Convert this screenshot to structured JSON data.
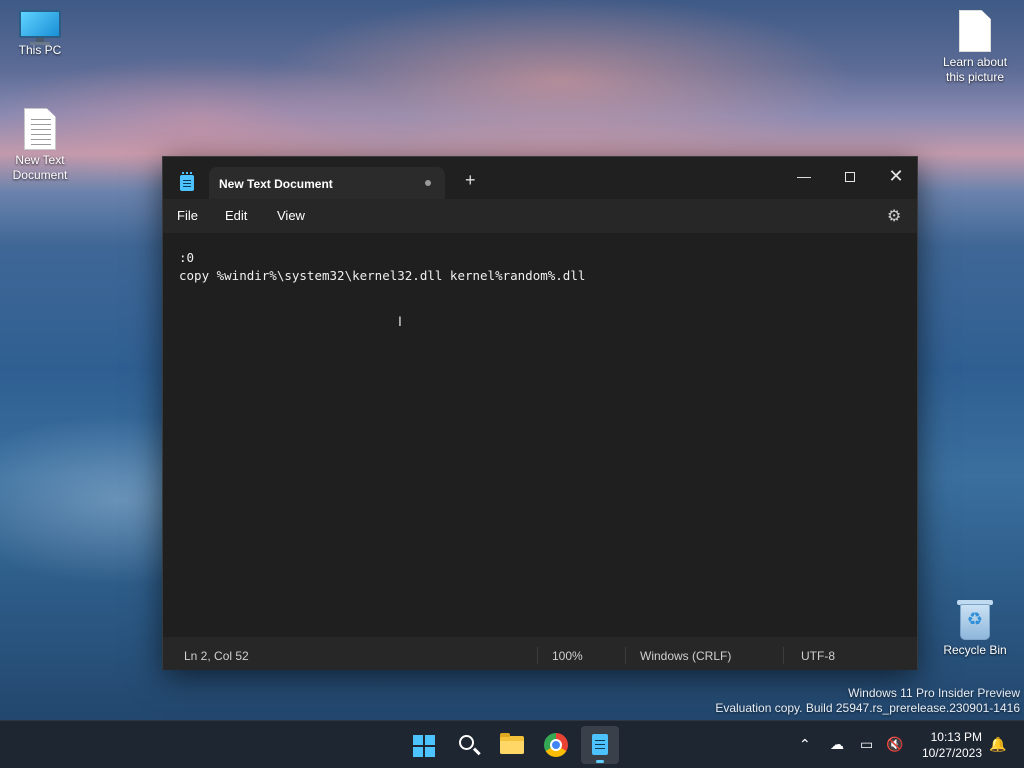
{
  "desktop": {
    "icons": [
      {
        "label": "This PC",
        "icon": "this-pc-icon"
      },
      {
        "label": "New Text\nDocument",
        "icon": "text-document-icon"
      },
      {
        "label": "Learn about\nthis picture",
        "icon": "learn-picture-icon"
      },
      {
        "label": "Recycle Bin",
        "icon": "recycle-bin-icon"
      }
    ]
  },
  "notepad": {
    "tab_title": "New Text Document",
    "unsaved_indicator": "•",
    "new_tab_label": "+",
    "window_controls": {
      "minimize": "—",
      "maximize": "□",
      "close": "✕"
    },
    "menu": {
      "file": "File",
      "edit": "Edit",
      "view": "View"
    },
    "settings_icon": "⚙",
    "content_lines": [
      ":0",
      "copy %windir%\\system32\\kernel32.dll kernel%random%.dll"
    ],
    "status": {
      "position": "Ln 2, Col 52",
      "zoom": "100%",
      "line_ending": "Windows (CRLF)",
      "encoding": "UTF-8"
    }
  },
  "watermark": {
    "line1": "Windows 11 Pro Insider Preview",
    "line2": "Evaluation copy. Build 25947.rs_prerelease.230901-1416"
  },
  "taskbar": {
    "apps": [
      "start-icon",
      "search-icon",
      "file-explorer-icon",
      "chrome-icon",
      "notepad-icon"
    ],
    "active_app": "notepad-icon",
    "tray": {
      "chevron": "^",
      "time": "10:13 PM",
      "date": "10/27/2023"
    }
  },
  "colors": {
    "accent": "#4cc2ff",
    "window_bg": "#272727",
    "editor_bg": "#1f1f1f"
  }
}
